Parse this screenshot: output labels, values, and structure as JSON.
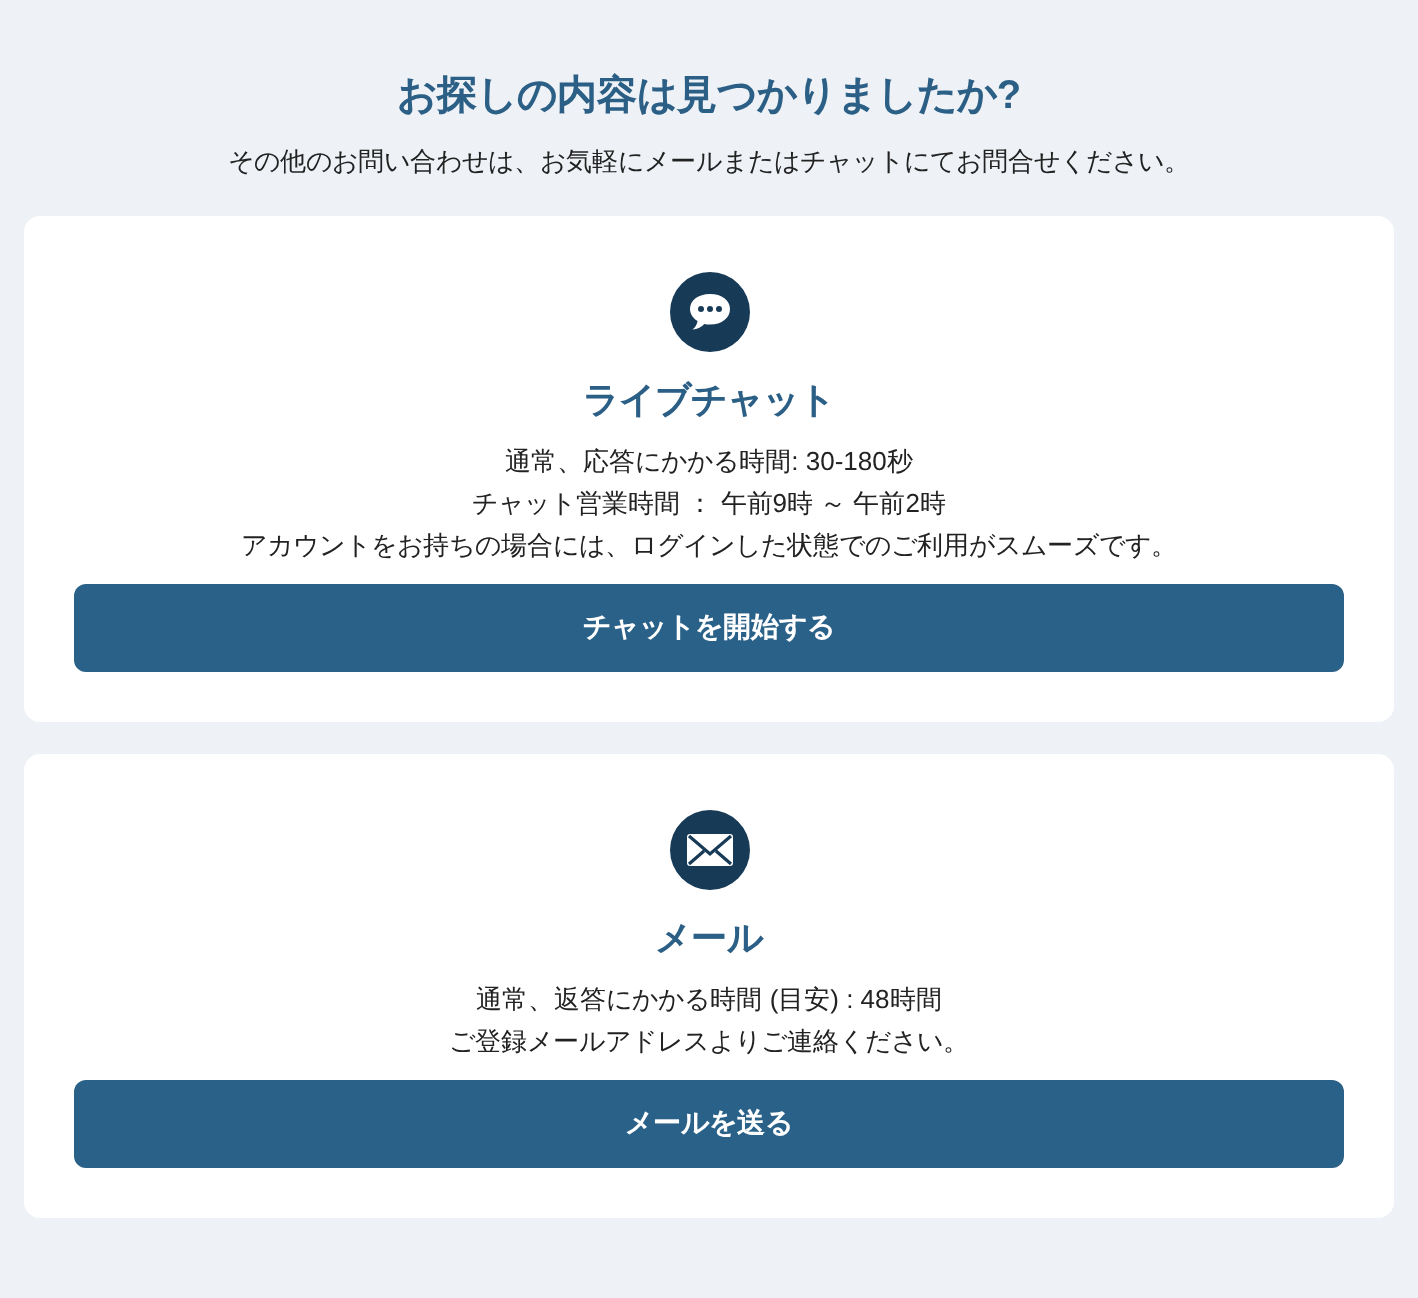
{
  "heading": "お探しの内容は見つかりましたか?",
  "subheading": "その他のお問い合わせは、お気軽にメールまたはチャットにてお問合せください。",
  "cards": [
    {
      "kind": "chat",
      "title": "ライブチャット",
      "lines": [
        "通常、応答にかかる時間: 30-180秒",
        "チャット営業時間 ： 午前9時 ～ 午前2時",
        "アカウントをお持ちの場合には、ログインした状態でのご利用がスムーズです。"
      ],
      "button": "チャットを開始する"
    },
    {
      "kind": "mail",
      "title": "メール",
      "lines": [
        "通常、返答にかかる時間 (目安) : 48時間",
        "ご登録メールアドレスよりご連絡ください。"
      ],
      "button": "メールを送る"
    }
  ]
}
